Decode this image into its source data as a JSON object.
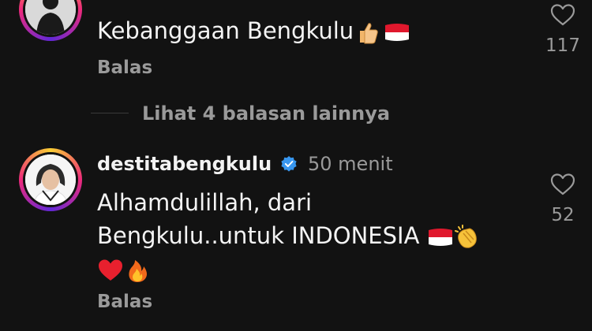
{
  "comments": [
    {
      "username": "",
      "time": "",
      "text": "Kebanggaan Bengkulu",
      "reply_label": "Balas",
      "like_count": "117"
    },
    {
      "username": "destitabengkulu",
      "time": "50 menit",
      "text_line1": "Alhamdulillah, dari",
      "text_line2": "Bengkulu..untuk INDONESIA",
      "reply_label": "Balas",
      "like_count": "52"
    }
  ],
  "view_more_label": "Lihat 4 balasan lainnya",
  "icons": [
    "heart-outline-icon",
    "verified-badge-icon",
    "thumbs-up-emoji",
    "indonesia-flag-emoji",
    "clapping-hands-emoji",
    "red-heart-emoji",
    "fire-emoji"
  ],
  "colors": {
    "background": "#121212",
    "muted": "#9a9a9a",
    "verified": "#3897f0",
    "text": "#f2f2f2"
  }
}
